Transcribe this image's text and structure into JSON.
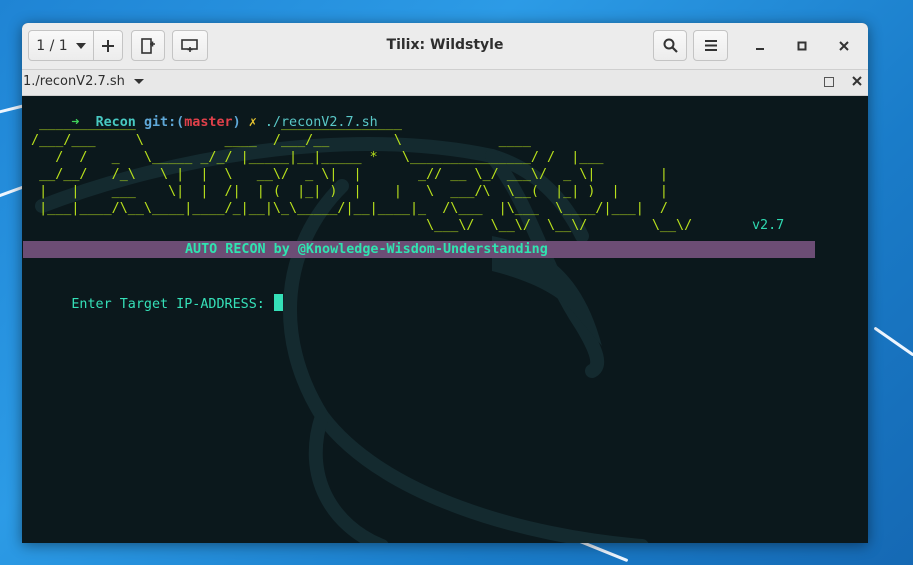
{
  "window": {
    "title": "Tilix: Wildstyle"
  },
  "headerbar": {
    "session_label": "1 / 1",
    "icons": [
      "chevron-down-icon",
      "plus-icon",
      "add-terminal-icon",
      "sync-input-icon",
      "search-icon",
      "hamburger-menu-icon",
      "minimize-icon",
      "maximize-icon",
      "close-icon"
    ]
  },
  "terminal_tab": {
    "title": "1./reconV2.7.sh"
  },
  "terminal": {
    "prompt": {
      "arrow": "➜",
      "dir": "Recon",
      "git": "git:(",
      "branch": "master",
      "git_close": ")",
      "dirty": "✗",
      "command": "./reconV2.7.sh"
    },
    "ascii_art": [
      "  ____________                  _______________",
      " /___/___     \\          ____  /___/__        \\            ____",
      "    /  /   _   \\_____ _/_/ |_____|__|_____ *   \\_______________/ /  |___",
      "  __/__/   /_\\   \\ |  |  \\   __\\/  _ \\|  |       _// __ \\_/ ___\\/  _ \\|        |",
      "  |   |    ___    \\|  |  /|  | (  |_| )  |    |   \\  ___/\\  \\__(  |_| )  |     |",
      "  |___|____/\\__\\____|____/_|__|\\_\\_____/|__|____|_  /\\___  |\\___  \\____/|___|  /",
      "                                                  \\___\\/  \\__\\/  \\__\\/        \\__\\/   "
    ],
    "version": "v2.7",
    "banner": "AUTO RECON by @Knowledge-Wisdom-Understanding",
    "input_prompt": "Enter Target IP-ADDRESS: "
  },
  "colors": {
    "desktop": "#1f84d4",
    "terminal_bg": "#0b181c",
    "ascii_green": "#b8e01c",
    "banner_bg": "#6c4d75",
    "banner_text": "#2fe4b0",
    "branch_red": "#e0404a"
  }
}
